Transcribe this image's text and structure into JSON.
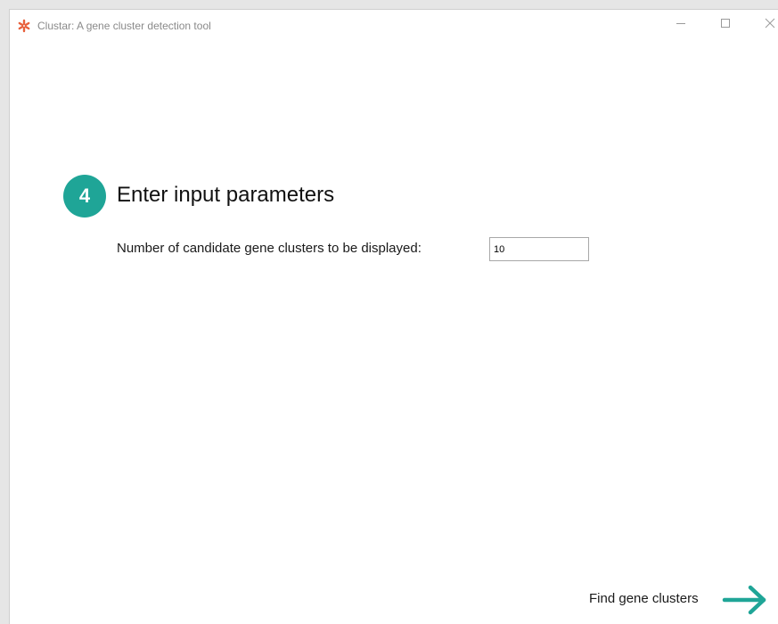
{
  "window": {
    "title": "Clustar: A gene cluster detection tool",
    "app_icon": "asterisk-logo-icon",
    "controls": [
      "minimize-icon",
      "maximize-icon",
      "close-icon"
    ]
  },
  "step": {
    "number": "4",
    "title": "Enter input parameters"
  },
  "parameters": {
    "candidate_clusters_label": "Number of candidate gene clusters to be displayed:",
    "candidate_clusters_value": "10"
  },
  "action": {
    "label": "Find gene clusters",
    "icon": "arrow-right-icon"
  },
  "colors": {
    "accent": "#1fa597",
    "logo": "#e8603c"
  }
}
